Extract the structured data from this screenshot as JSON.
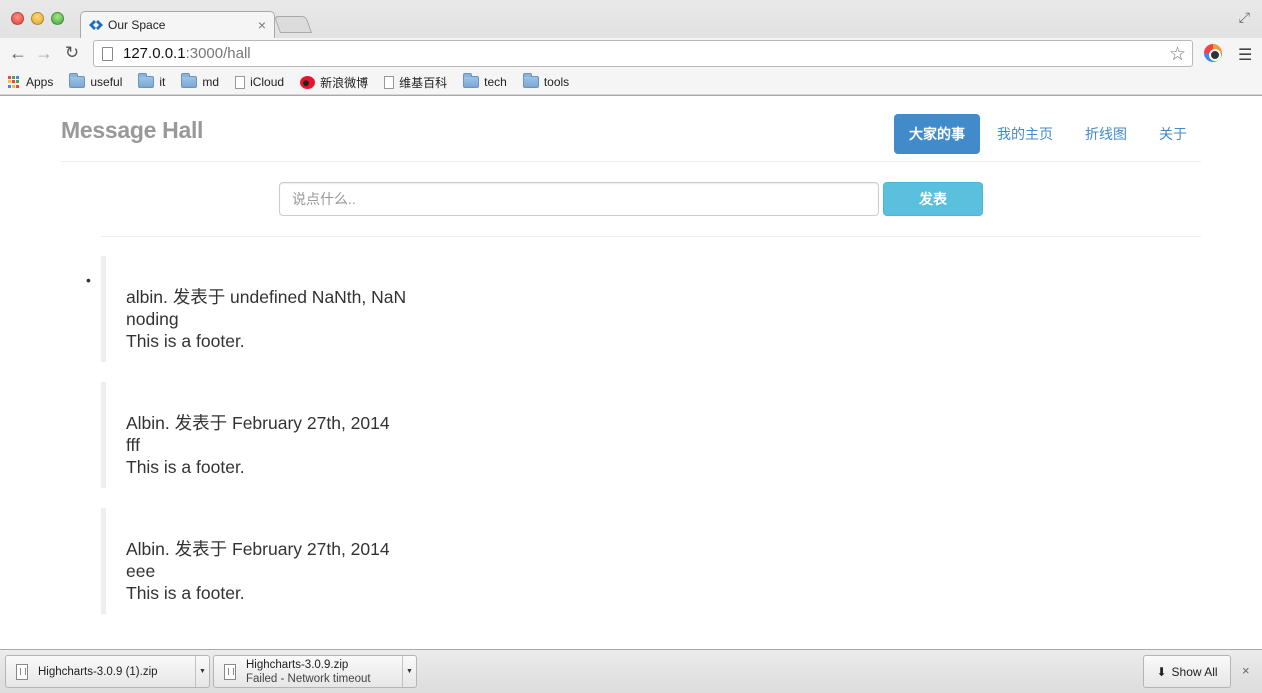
{
  "browser": {
    "tab_title": "Our Space",
    "tab_close": "×",
    "url_host": "127.0.0.1",
    "url_rest": ":3000/hall",
    "bookmarks": [
      {
        "label": "Apps",
        "icon": "apps-grid-icon"
      },
      {
        "label": "useful",
        "icon": "folder-icon"
      },
      {
        "label": "it",
        "icon": "folder-icon"
      },
      {
        "label": "md",
        "icon": "folder-icon"
      },
      {
        "label": "iCloud",
        "icon": "page-icon"
      },
      {
        "label": "新浪微博",
        "icon": "weibo-icon"
      },
      {
        "label": "维基百科",
        "icon": "page-icon"
      },
      {
        "label": "tech",
        "icon": "folder-icon"
      },
      {
        "label": "tools",
        "icon": "folder-icon"
      }
    ]
  },
  "header": {
    "brand": "Message Hall",
    "nav": [
      {
        "label": "大家的事",
        "active": true
      },
      {
        "label": "我的主页",
        "active": false
      },
      {
        "label": "折线图",
        "active": false
      },
      {
        "label": "关于",
        "active": false
      }
    ]
  },
  "post_form": {
    "placeholder": "说点什么..",
    "submit_label": "发表"
  },
  "messages": [
    {
      "head": "albin. 发表于 undefined NaNth, NaN",
      "body": "noding",
      "footer": "This is a footer."
    },
    {
      "head": "Albin. 发表于 February 27th, 2014",
      "body": "fff",
      "footer": "This is a footer."
    },
    {
      "head": "Albin. 发表于 February 27th, 2014",
      "body": "eee",
      "footer": "This is a footer."
    }
  ],
  "downloads": [
    {
      "filename": "Highcharts-3.0.9 (1).zip",
      "status": ""
    },
    {
      "filename": "Highcharts-3.0.9.zip",
      "status": "Failed - Network timeout"
    }
  ],
  "download_shelf": {
    "show_all_label": "Show All",
    "close_label": "×"
  }
}
